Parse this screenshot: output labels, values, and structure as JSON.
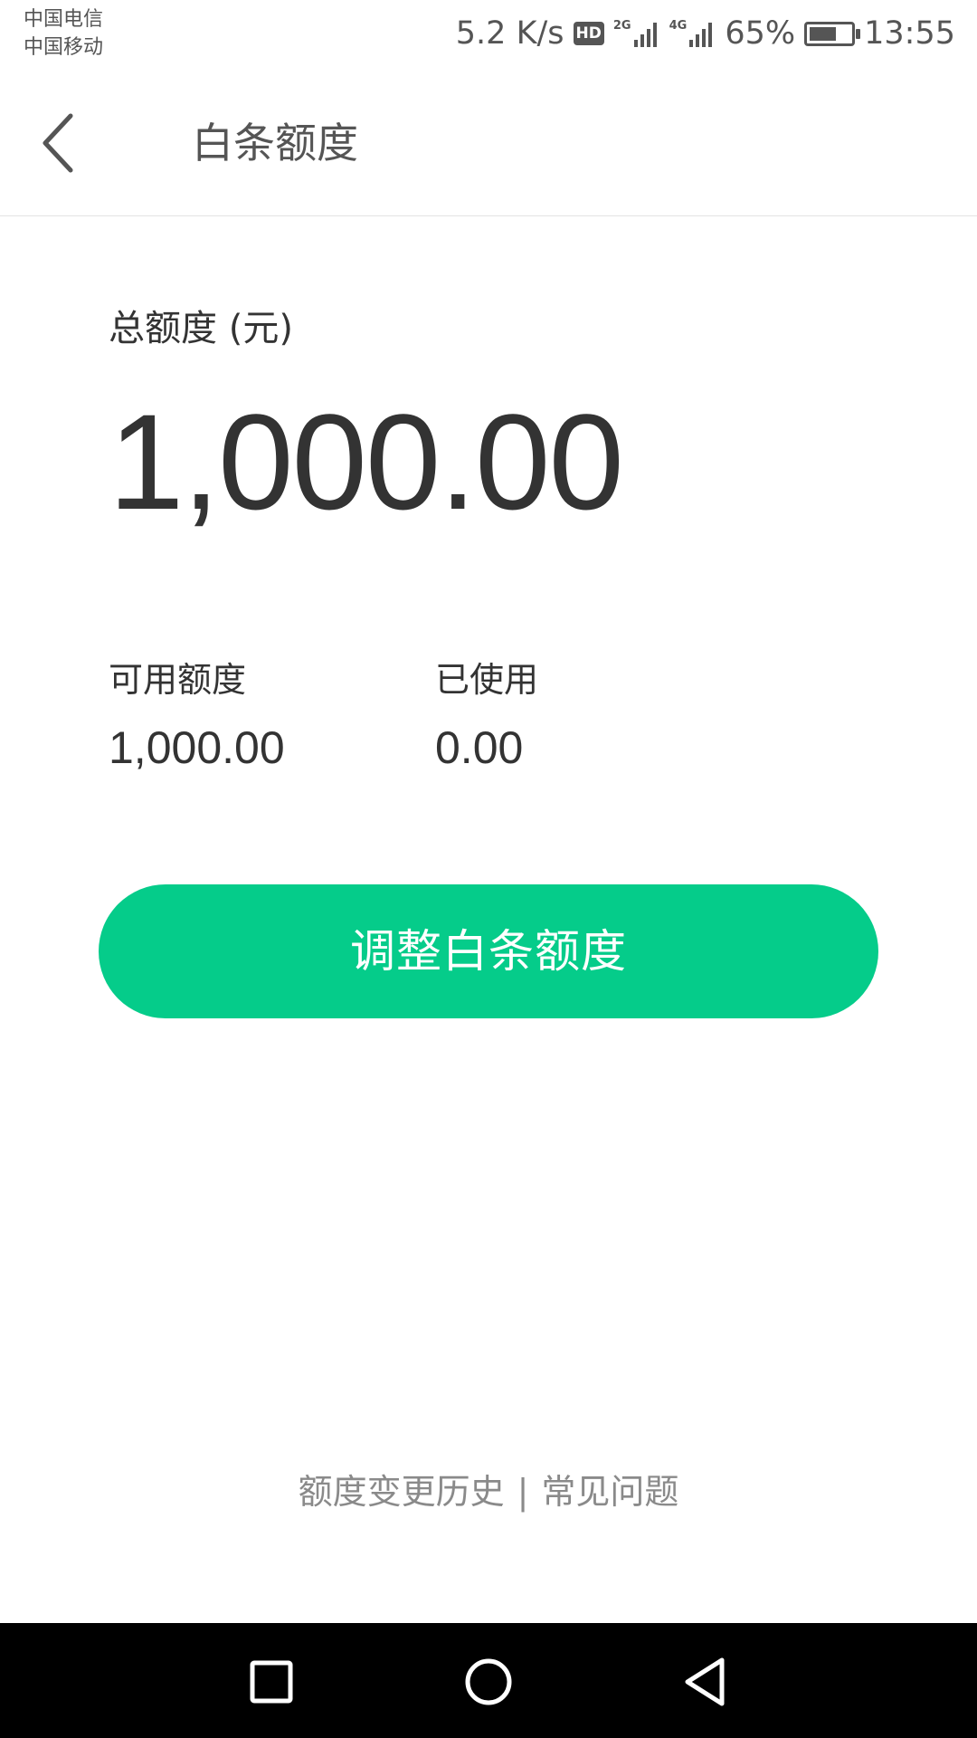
{
  "status_bar": {
    "carrier_1": "中国电信",
    "carrier_2": "中国移动",
    "network_speed": "5.2 K/s",
    "hd_label": "HD",
    "signal_1_tag": "2G",
    "signal_2_tag": "4G",
    "battery_percent": "65%",
    "battery_level": 0.65,
    "time": "13:55"
  },
  "header": {
    "back_icon": "chevron-left-icon",
    "title": "白条额度"
  },
  "credit": {
    "total_label": "总额度 (元)",
    "total_value": "1,000.00",
    "available_label": "可用额度",
    "available_value": "1,000.00",
    "used_label": "已使用",
    "used_value": "0.00"
  },
  "actions": {
    "adjust_label": "调整白条额度"
  },
  "footer": {
    "history_link": "额度变更历史",
    "separator": "|",
    "faq_link": "常见问题"
  },
  "nav_bar": {
    "recent_icon": "square-icon",
    "home_icon": "circle-icon",
    "back_icon": "triangle-back-icon"
  },
  "colors": {
    "accent": "#05cc8a",
    "text_primary": "#333333",
    "text_secondary": "#8a8a8a",
    "nav_bar": "#000000"
  }
}
